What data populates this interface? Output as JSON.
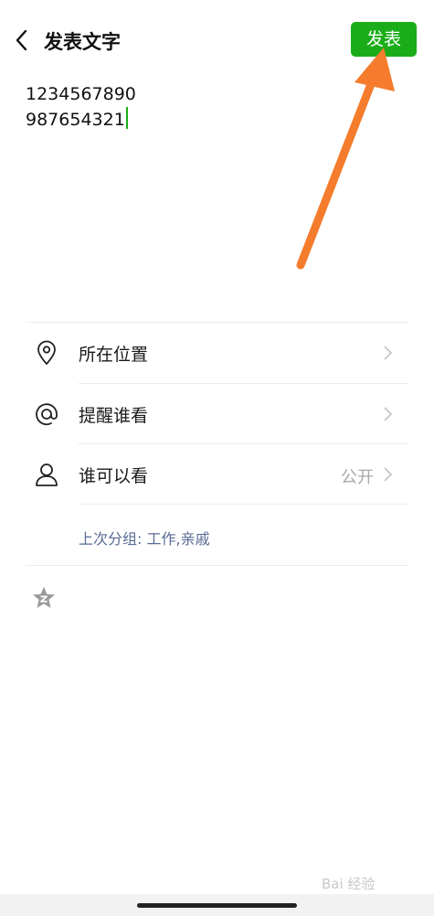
{
  "header": {
    "back_icon": "chevron-left-icon",
    "title": "发表文字",
    "publish_label": "发表",
    "publish_color": "#1aad19"
  },
  "post": {
    "lines": [
      "1234567890",
      "987654321"
    ]
  },
  "options": [
    {
      "icon": "location-pin-icon",
      "label": "所在位置",
      "value": ""
    },
    {
      "icon": "at-mention-icon",
      "label": "提醒谁看",
      "value": ""
    },
    {
      "icon": "person-icon",
      "label": "谁可以看",
      "value": "公开"
    }
  ],
  "group_note": "上次分组: 工作,亲戚",
  "footer_icon": "star-icon",
  "annotation": {
    "color": "#f47c2c"
  },
  "watermark": "Bai 经验"
}
